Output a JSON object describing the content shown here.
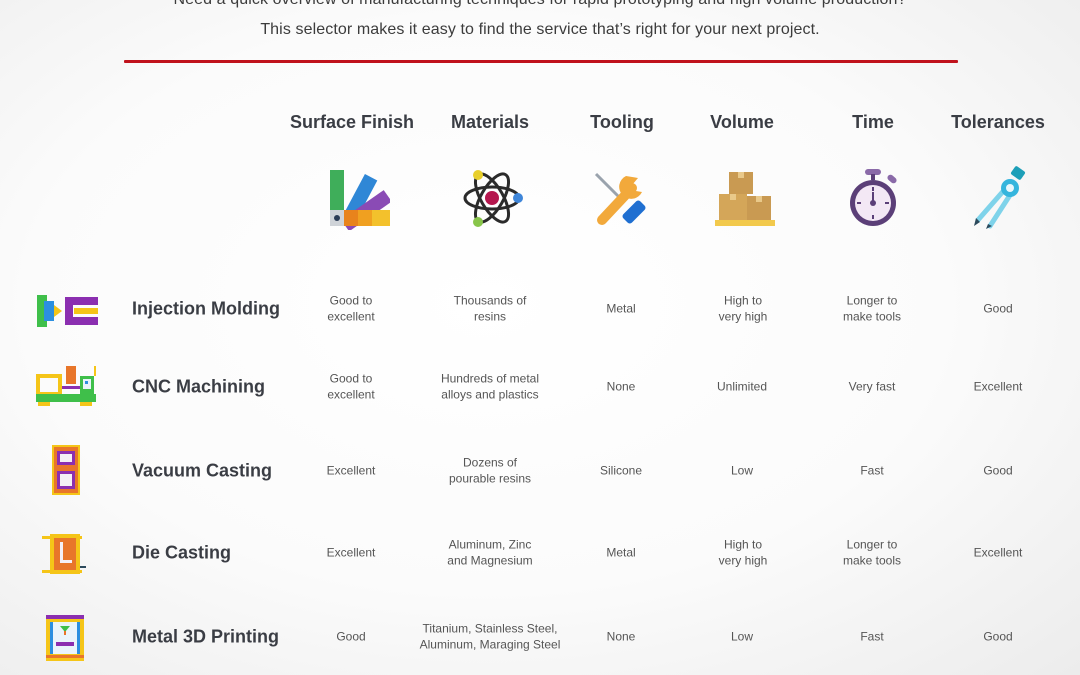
{
  "intro": {
    "line1": "Need a quick overview of manufacturing techniques for rapid prototyping and high volume production?",
    "line2": "This selector makes it easy to find the service that’s right for your next project."
  },
  "colors": {
    "accent_rule": "#c0121c",
    "heading_text": "#3a3d44",
    "cell_text": "#555555"
  },
  "columns": [
    {
      "label": "Surface Finish",
      "icon": "color-swatch-icon"
    },
    {
      "label": "Materials",
      "icon": "atom-icon"
    },
    {
      "label": "Tooling",
      "icon": "wrench-screwdriver-icon"
    },
    {
      "label": "Volume",
      "icon": "stacked-boxes-icon"
    },
    {
      "label": "Time",
      "icon": "stopwatch-icon"
    },
    {
      "label": "Tolerances",
      "icon": "drafting-compass-icon"
    }
  ],
  "rows": [
    {
      "label": "Injection Molding",
      "icon": "injection-molding-machine-icon",
      "cells": [
        "Good to\nexcellent",
        "Thousands of\nresins",
        "Metal",
        "High to\nvery high",
        "Longer to\nmake tools",
        "Good"
      ]
    },
    {
      "label": "CNC Machining",
      "icon": "cnc-machine-icon",
      "cells": [
        "Good to\nexcellent",
        "Hundreds of metal\nalloys and plastics",
        "None",
        "Unlimited",
        "Very fast",
        "Excellent"
      ]
    },
    {
      "label": "Vacuum Casting",
      "icon": "vacuum-casting-mold-icon",
      "cells": [
        "Excellent",
        "Dozens of\npourable resins",
        "Silicone",
        "Low",
        "Fast",
        "Good"
      ]
    },
    {
      "label": "Die Casting",
      "icon": "die-casting-machine-icon",
      "cells": [
        "Excellent",
        "Aluminum, Zinc\nand Magnesium",
        "Metal",
        "High to\nvery high",
        "Longer to\nmake tools",
        "Excellent"
      ]
    },
    {
      "label": "Metal 3D Printing",
      "icon": "metal-3d-printer-icon",
      "cells": [
        "Good",
        "Titanium, Stainless Steel,\nAluminum, Maraging Steel",
        "None",
        "Low",
        "Fast",
        "Good"
      ]
    }
  ]
}
